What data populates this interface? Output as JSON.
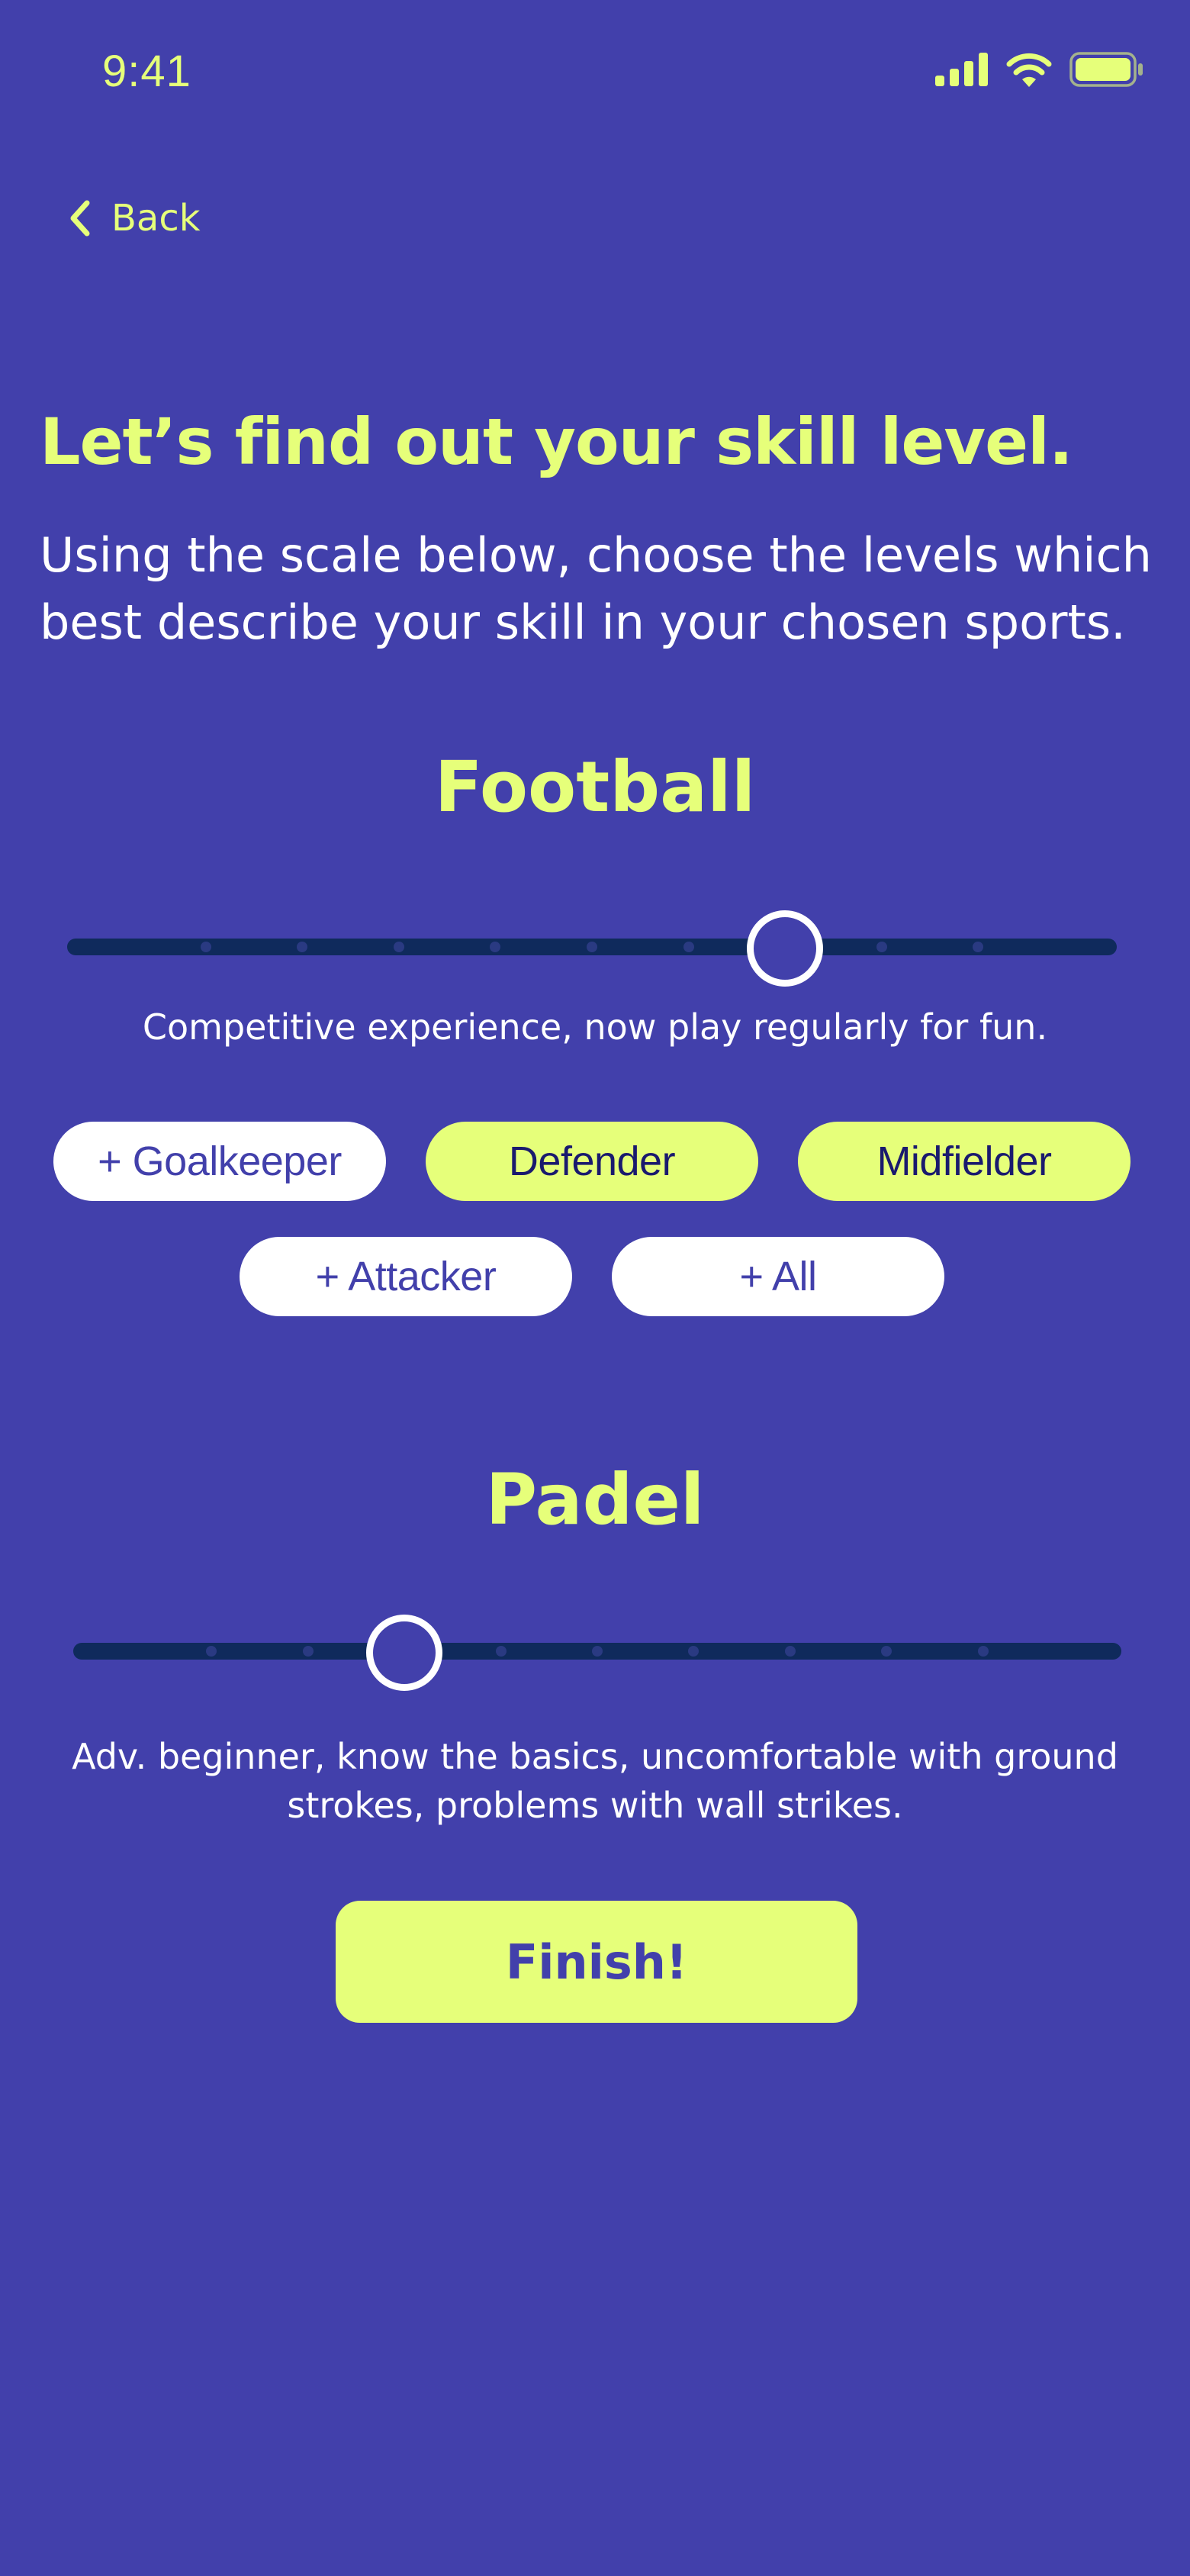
{
  "status_bar": {
    "time": "9:41"
  },
  "nav": {
    "back_label": "Back"
  },
  "header": {
    "title": "Let’s find out your skill level.",
    "subtitle": "Using the scale below, choose the levels which best describe your skill in your chosen sports."
  },
  "sports": [
    {
      "name": "Football",
      "slider": {
        "steps": 11,
        "selected_step": 8
      },
      "description": "Competitive experience, now play regularly for fun.",
      "positions": [
        {
          "label": "+ Goalkeeper",
          "selected": false
        },
        {
          "label": "Defender",
          "selected": true
        },
        {
          "label": "Midfielder",
          "selected": true
        },
        {
          "label": "+ Attacker",
          "selected": false
        },
        {
          "label": "+ All",
          "selected": false
        }
      ]
    },
    {
      "name": "Padel",
      "slider": {
        "steps": 11,
        "selected_step": 4
      },
      "description": "Adv. beginner, know the basics, uncomfortable with ground strokes, problems with wall strikes."
    }
  ],
  "finish_label": "Finish!",
  "colors": {
    "background": "#4240ab",
    "accent": "#e6ff7a",
    "track": "#0f2a5c",
    "text": "#ffffff"
  },
  "icons": [
    "signal-icon",
    "wifi-icon",
    "battery-icon",
    "chevron-left-icon"
  ]
}
